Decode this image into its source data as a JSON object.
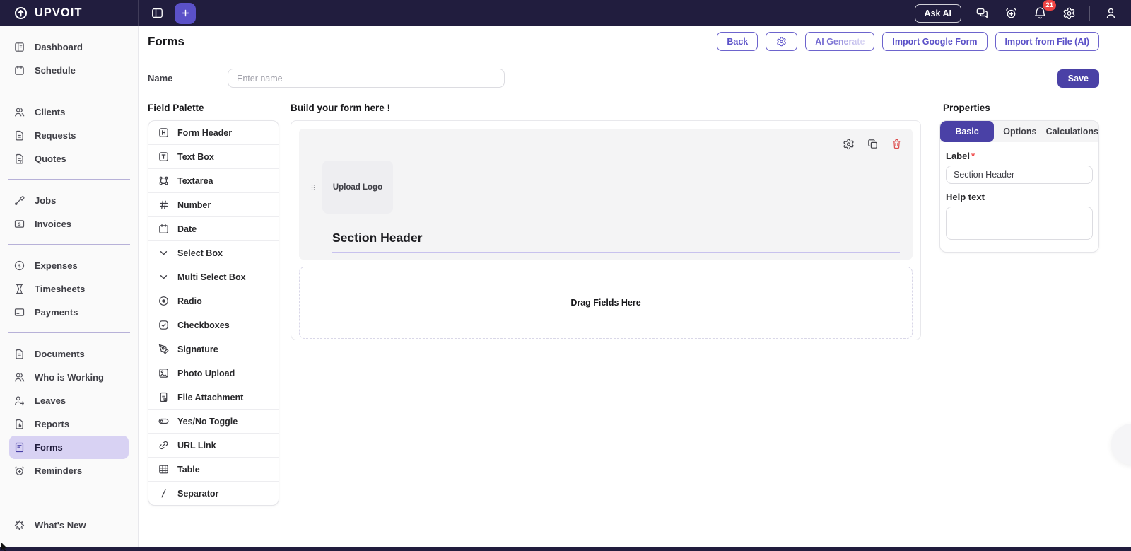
{
  "topbar": {
    "brand": "UPVOIT",
    "ask_ai_label": "Ask AI",
    "notification_badge": "21"
  },
  "sidebar": {
    "groups": [
      {
        "items": [
          {
            "label": "Dashboard",
            "icon": "dashboard-icon"
          },
          {
            "label": "Schedule",
            "icon": "schedule-icon"
          }
        ]
      },
      {
        "items": [
          {
            "label": "Clients",
            "icon": "clients-icon"
          },
          {
            "label": "Requests",
            "icon": "requests-icon"
          },
          {
            "label": "Quotes",
            "icon": "quotes-icon"
          }
        ]
      },
      {
        "items": [
          {
            "label": "Jobs",
            "icon": "jobs-icon"
          },
          {
            "label": "Invoices",
            "icon": "invoices-icon"
          }
        ]
      },
      {
        "items": [
          {
            "label": "Expenses",
            "icon": "expenses-icon"
          },
          {
            "label": "Timesheets",
            "icon": "timesheets-icon"
          },
          {
            "label": "Payments",
            "icon": "payments-icon"
          }
        ]
      },
      {
        "items": [
          {
            "label": "Documents",
            "icon": "documents-icon"
          },
          {
            "label": "Who is Working",
            "icon": "who-is-working-icon"
          },
          {
            "label": "Leaves",
            "icon": "leaves-icon"
          },
          {
            "label": "Reports",
            "icon": "reports-icon"
          },
          {
            "label": "Forms",
            "icon": "forms-icon",
            "selected": true
          },
          {
            "label": "Reminders",
            "icon": "reminders-icon"
          }
        ]
      }
    ],
    "footer_item": {
      "label": "What's New",
      "icon": "sparkle-icon"
    }
  },
  "page": {
    "title": "Forms",
    "actions": {
      "back": "Back",
      "ai_generate": "AI Generate",
      "import_google": "Import Google Form",
      "import_file": "Import from File (AI)"
    }
  },
  "name_row": {
    "label": "Name",
    "placeholder": "Enter name",
    "save": "Save"
  },
  "palette": {
    "title": "Field Palette",
    "items": [
      {
        "label": "Form Header",
        "icon": "form-header-icon"
      },
      {
        "label": "Text Box",
        "icon": "text-box-icon"
      },
      {
        "label": "Textarea",
        "icon": "textarea-icon"
      },
      {
        "label": "Number",
        "icon": "number-icon"
      },
      {
        "label": "Date",
        "icon": "date-icon"
      },
      {
        "label": "Select Box",
        "icon": "chevron-down-icon"
      },
      {
        "label": "Multi Select Box",
        "icon": "chevron-down-icon"
      },
      {
        "label": "Radio",
        "icon": "radio-icon"
      },
      {
        "label": "Checkboxes",
        "icon": "checkbox-icon"
      },
      {
        "label": "Signature",
        "icon": "signature-icon"
      },
      {
        "label": "Photo Upload",
        "icon": "photo-upload-icon"
      },
      {
        "label": "File Attachment",
        "icon": "file-attachment-icon"
      },
      {
        "label": "Yes/No Toggle",
        "icon": "toggle-icon"
      },
      {
        "label": "URL Link",
        "icon": "link-icon"
      },
      {
        "label": "Table",
        "icon": "table-icon"
      },
      {
        "label": "Separator",
        "icon": "separator-icon"
      }
    ]
  },
  "canvas": {
    "title": "Build your form here !",
    "upload_logo_label": "Upload Logo",
    "section_title": "Section Header",
    "drop_hint": "Drag Fields Here"
  },
  "properties": {
    "title": "Properties",
    "tabs": [
      {
        "label": "Basic",
        "active": true
      },
      {
        "label": "Options",
        "active": false
      },
      {
        "label": "Calculations",
        "active": false
      }
    ],
    "label_field": {
      "label": "Label",
      "required_marker": "*",
      "value": "Section Header"
    },
    "help_field": {
      "label": "Help text",
      "value": ""
    }
  },
  "colors": {
    "topbar": "#211d3e",
    "accent": "#5b51c8",
    "accent_dark": "#4a41a6",
    "selected_bg": "#d8d2f3",
    "badge_red": "#ef4444",
    "danger": "#dc4b4b"
  }
}
